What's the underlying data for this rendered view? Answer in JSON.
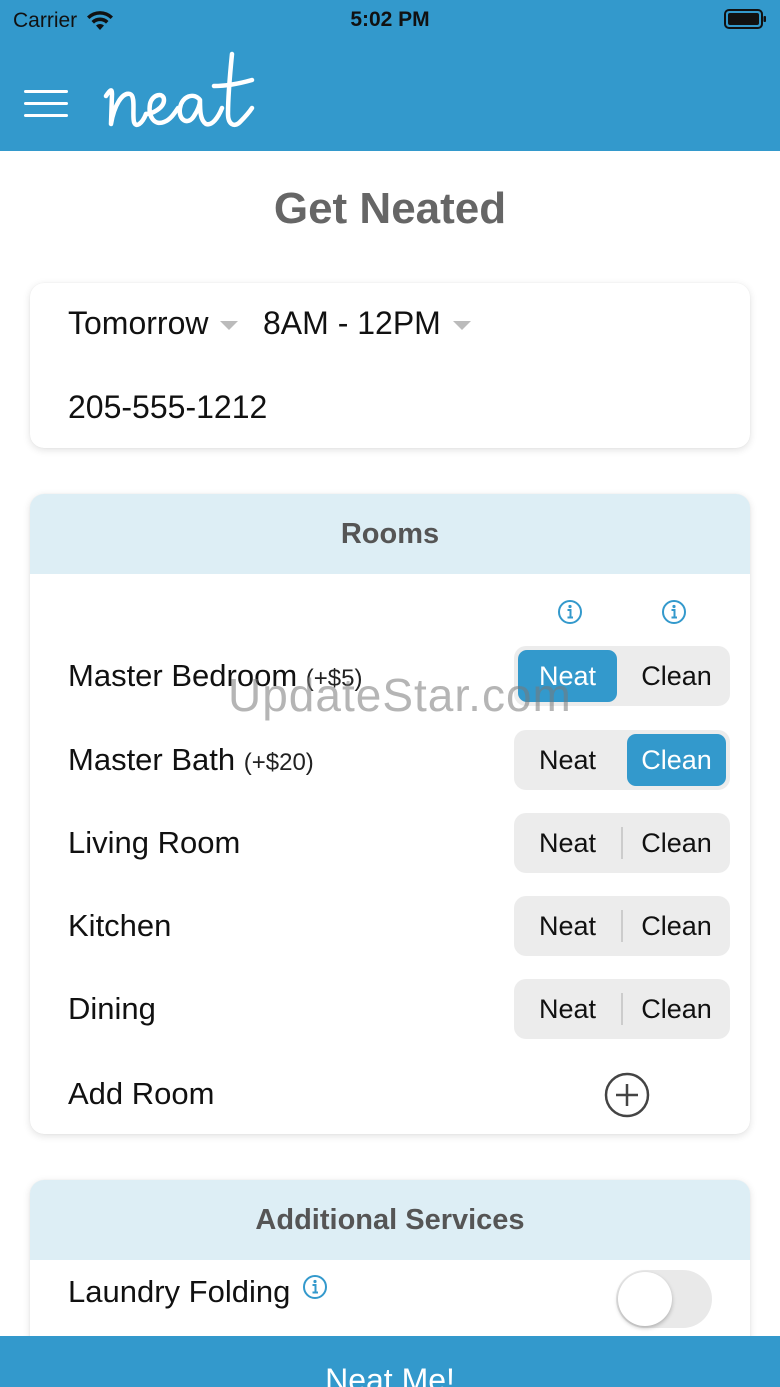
{
  "status_bar": {
    "carrier": "Carrier",
    "time": "5:02 PM"
  },
  "header": {
    "logo_text": "neat",
    "menu_icon": "hamburger-menu-icon"
  },
  "page": {
    "title": "Get Neated"
  },
  "schedule": {
    "day": "Tomorrow",
    "time_window": "8AM - 12PM",
    "phone": "205-555-1212"
  },
  "rooms": {
    "header": "Rooms",
    "options": [
      "Neat",
      "Clean"
    ],
    "items": [
      {
        "name": "Master Bedroom",
        "extra": "(+$5)",
        "selected": "Neat"
      },
      {
        "name": "Master Bath",
        "extra": "(+$20)",
        "selected": "Clean"
      },
      {
        "name": "Living Room",
        "extra": "",
        "selected": ""
      },
      {
        "name": "Kitchen",
        "extra": "",
        "selected": ""
      },
      {
        "name": "Dining",
        "extra": "",
        "selected": ""
      }
    ],
    "add_label": "Add Room"
  },
  "services": {
    "header": "Additional Services",
    "items": [
      {
        "name": "Laundry Folding",
        "enabled": false
      }
    ]
  },
  "watermark": "UpdateStar.com",
  "cta": {
    "label": "Neat Me!"
  },
  "colors": {
    "primary": "#3399cc",
    "header_tint": "#ddeef5"
  }
}
